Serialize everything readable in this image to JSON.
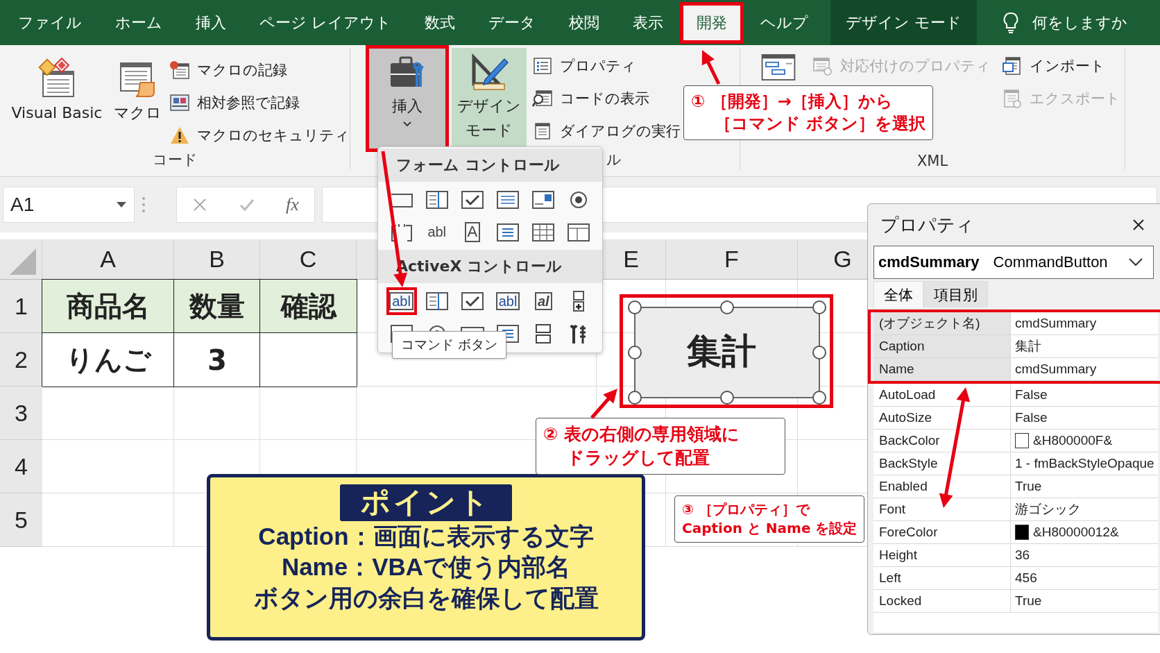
{
  "menu_tabs": [
    {
      "label": "ファイル",
      "selected": false
    },
    {
      "label": "ホーム",
      "selected": false
    },
    {
      "label": "挿入",
      "selected": false
    },
    {
      "label": "ページ レイアウト",
      "selected": false
    },
    {
      "label": "数式",
      "selected": false
    },
    {
      "label": "データ",
      "selected": false
    },
    {
      "label": "校閲",
      "selected": false
    },
    {
      "label": "表示",
      "selected": false
    },
    {
      "label": "開発",
      "selected": true
    },
    {
      "label": "ヘルプ",
      "selected": false
    }
  ],
  "context_tab": {
    "label": "デザイン モード"
  },
  "tell_me": {
    "placeholder": "何をしますか"
  },
  "ribbon_groups": [
    {
      "kind": "code",
      "label": "コード",
      "large": [
        {
          "kind": "vb",
          "lines": [
            "Visual Basic"
          ],
          "pressed": false
        },
        {
          "kind": "macro",
          "lines": [
            "マクロ"
          ],
          "pressed": false
        }
      ],
      "columns": [
        [
          {
            "kind": "record",
            "label": "マクロの記録",
            "disabled": false
          },
          {
            "kind": "relative",
            "label": "相対参照で記録",
            "disabled": false
          },
          {
            "kind": "security",
            "label": "マクロのセキュリティ",
            "disabled": false
          }
        ]
      ]
    },
    {
      "kind": "controls",
      "label": "ル",
      "large": [
        {
          "kind": "insert",
          "lines": [
            "挿入"
          ],
          "pressed": true
        },
        {
          "kind": "design",
          "lines": [
            "デザイン",
            "モード"
          ],
          "pressed": true
        }
      ],
      "columns": [
        [
          {
            "kind": "properties",
            "label": "プロパティ",
            "disabled": false
          },
          {
            "kind": "code",
            "label": "コードの表示",
            "disabled": false
          },
          {
            "kind": "dialog",
            "label": "ダイアログの実行",
            "disabled": false
          }
        ]
      ]
    },
    {
      "kind": "xml",
      "label": "XML",
      "large": [
        {
          "kind": "xmlmap",
          "pressed": false
        }
      ],
      "columns": [
        [
          {
            "kind": "mapprops",
            "label": "対応付けのプロパティ",
            "disabled": true
          }
        ],
        [
          {
            "kind": "import",
            "label": "インポート",
            "disabled": false
          },
          {
            "kind": "export",
            "label": "エクスポート",
            "disabled": true
          }
        ]
      ]
    }
  ],
  "formula_bar": {
    "name_box": "A1",
    "function_label": "fx"
  },
  "sheet": {
    "columns": [
      "A",
      "B",
      "C",
      "E",
      "F",
      "G"
    ],
    "rows": [
      "1",
      "2",
      "3",
      "4",
      "5"
    ],
    "header": [
      "商品名",
      "数量",
      "確認"
    ],
    "data": [
      [
        "りんご",
        "3"
      ]
    ]
  },
  "insert_menu": {
    "sections": [
      {
        "title": "フォーム コントロール",
        "items": [
          {
            "kind": "button",
            "selected": false
          },
          {
            "kind": "combo",
            "selected": false
          },
          {
            "kind": "check",
            "selected": false
          },
          {
            "kind": "list",
            "selected": false
          },
          {
            "kind": "scroll",
            "selected": false
          },
          {
            "kind": "radio",
            "selected": false
          },
          {
            "kind": "group",
            "selected": false
          },
          {
            "kind": "label",
            "label": "abl",
            "selected": false
          },
          {
            "kind": "boxed",
            "label": "A",
            "selected": false
          },
          {
            "kind": "listbox",
            "selected": false
          },
          {
            "kind": "grid",
            "selected": false
          },
          {
            "kind": "dialog",
            "selected": false
          }
        ]
      },
      {
        "title": "ActiveX コントロール",
        "items": [
          {
            "kind": "command",
            "label": "abl",
            "selected": true
          },
          {
            "kind": "combo",
            "selected": false
          },
          {
            "kind": "check",
            "selected": false
          },
          {
            "kind": "textbox",
            "label": "abl",
            "selected": false
          },
          {
            "kind": "italic",
            "label": "al",
            "selected": false
          },
          {
            "kind": "spin",
            "selected": false
          },
          {
            "kind": "image",
            "selected": false
          },
          {
            "kind": "radio",
            "selected": false
          },
          {
            "kind": "toggle",
            "selected": false
          },
          {
            "kind": "listbox",
            "selected": false
          },
          {
            "kind": "bars",
            "selected": false
          },
          {
            "kind": "tools",
            "selected": false
          }
        ]
      }
    ]
  },
  "tooltip": {
    "text": "コマンド ボタン"
  },
  "button_shape": {
    "caption": "集計"
  },
  "callouts": [
    {
      "lines": [
        "① ［開発］→［挿入］から",
        "［コマンド ボタン］を選択"
      ]
    },
    {
      "lines": [
        "② 表の右側の専用領域に",
        "ドラッグして配置"
      ]
    },
    {
      "lines": [
        "③ ［プロパティ］で",
        "Caption と Name を設定"
      ]
    }
  ],
  "point_box": {
    "title": "ポイント",
    "lines": [
      "Caption：画面に表示する文字",
      "Name：VBAで使う内部名",
      "ボタン用の余白を確保して配置"
    ]
  },
  "properties": {
    "title": "プロパティ",
    "object_name": "cmdSummary",
    "object_type": "CommandButton",
    "tabs": [
      {
        "label": "全体",
        "selected": true
      },
      {
        "label": "項目別",
        "selected": false
      }
    ],
    "rows": [
      {
        "name": "(オブジェクト名)",
        "value": "cmdSummary",
        "highlighted": true
      },
      {
        "name": "Caption",
        "value": "集計",
        "highlighted": true
      },
      {
        "name": "Name",
        "value": "cmdSummary",
        "highlighted": true
      },
      {
        "name": "AutoLoad",
        "value": "False",
        "highlighted": false
      },
      {
        "name": "AutoSize",
        "value": "False",
        "highlighted": false
      },
      {
        "name": "BackColor",
        "value": "&H800000F&",
        "color": "#ffffff",
        "highlighted": false
      },
      {
        "name": "BackStyle",
        "value": "1 - fmBackStyleOpaque",
        "highlighted": false
      },
      {
        "name": "Enabled",
        "value": "True",
        "highlighted": false
      },
      {
        "name": "Font",
        "value": "游ゴシック",
        "highlighted": false
      },
      {
        "name": "ForeColor",
        "value": "&H80000012&",
        "color": "#000000",
        "highlighted": false
      },
      {
        "name": "Height",
        "value": "36",
        "highlighted": false
      },
      {
        "name": "Left",
        "value": "456",
        "highlighted": false
      },
      {
        "name": "Locked",
        "value": "True",
        "highlighted": false
      }
    ]
  }
}
